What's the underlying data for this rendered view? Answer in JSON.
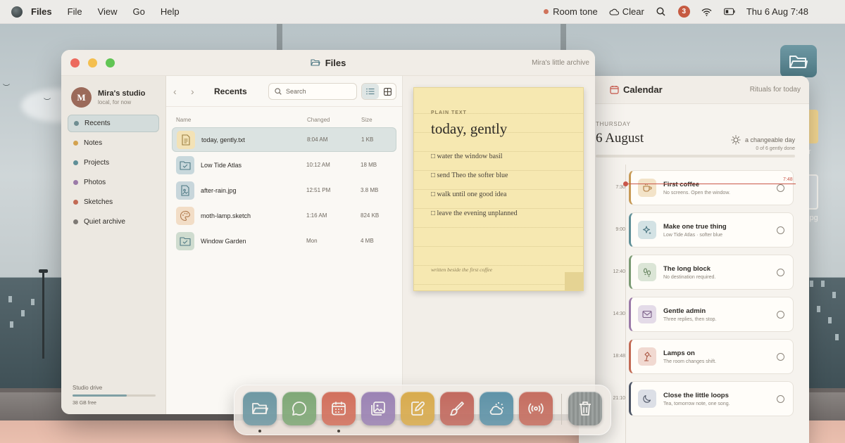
{
  "menubar": {
    "app": "Files",
    "menus": [
      "File",
      "View",
      "Go",
      "Help"
    ],
    "status": {
      "sound": "Room tone",
      "weather": "Clear",
      "notifications": "3",
      "datetime": "Thu 6 Aug  7:48"
    }
  },
  "files_window": {
    "title": "Files",
    "subtitle": "Mira's little archive",
    "profile": {
      "initial": "M",
      "name": "Mira's studio",
      "sub": "local, for now"
    },
    "sidebar": [
      {
        "label": "Recents",
        "color": "#6f8e92",
        "active": true
      },
      {
        "label": "Notes",
        "color": "#d3a24f"
      },
      {
        "label": "Projects",
        "color": "#5f8f97"
      },
      {
        "label": "Photos",
        "color": "#9b7aa8"
      },
      {
        "label": "Sketches",
        "color": "#c26a54"
      },
      {
        "label": "Quiet archive",
        "color": "#7e7a75"
      }
    ],
    "drive": {
      "label": "Studio drive",
      "used": 0.65,
      "free": "38 GB free"
    },
    "toolbar": {
      "title": "Recents",
      "search_placeholder": "Search"
    },
    "columns": {
      "name": "Name",
      "changed": "Changed",
      "size": "Size"
    },
    "files": [
      {
        "name": "today, gently.txt",
        "changed": "8:04 AM",
        "size": "1 KB",
        "icon": "text-file-icon",
        "bg": "#f3e2b6",
        "active": true
      },
      {
        "name": "Low Tide Atlas",
        "changed": "10:12 AM",
        "size": "18 MB",
        "icon": "folder-icon",
        "bg": "#c8d8dc"
      },
      {
        "name": "after-rain.jpg",
        "changed": "12:51 PM",
        "size": "3.8 MB",
        "icon": "image-file-icon",
        "bg": "#c8d6db"
      },
      {
        "name": "moth-lamp.sketch",
        "changed": "1:16 AM",
        "size": "824 KB",
        "icon": "palette-icon",
        "bg": "#f2ddc6"
      },
      {
        "name": "Window Garden",
        "changed": "Mon",
        "size": "4 MB",
        "icon": "folder-icon",
        "bg": "#cfdccf"
      }
    ],
    "preview": {
      "kind": "PLAIN TEXT",
      "title": "today, gently",
      "lines": [
        "□ water the window basil",
        "□ send Theo the softer blue",
        "□ walk until one good idea",
        "□ leave the evening unplanned"
      ],
      "footer": "written beside the first coffee"
    }
  },
  "calendar_window": {
    "title": "Calendar",
    "subtitle": "Rituals for today",
    "day": "THURSDAY",
    "date": "6 August",
    "weather": "a changeable day",
    "progress_text": "0 of 6 gently done",
    "progress": 0,
    "now_label": "7:48",
    "events": [
      {
        "time": "7:30",
        "title": "First coffee",
        "note": "No screens. Open the window.",
        "color": "#c79a55",
        "bg": "#f3e3c8",
        "icon": "coffee-icon"
      },
      {
        "time": "9:00",
        "title": "Make one true thing",
        "note": "Low Tide Atlas · softer blue",
        "color": "#5f8f97",
        "bg": "#d3e2e4",
        "icon": "sparkle-icon"
      },
      {
        "time": "12:40",
        "title": "The long block",
        "note": "No destination required.",
        "color": "#7a9a73",
        "bg": "#dbe5d6",
        "icon": "footprints-icon"
      },
      {
        "time": "14:30",
        "title": "Gentle admin",
        "note": "Three replies, then stop.",
        "color": "#9b7aa8",
        "bg": "#e4dbe8",
        "icon": "mail-icon"
      },
      {
        "time": "18:48",
        "title": "Lamps on",
        "note": "The room changes shift.",
        "color": "#c26a54",
        "bg": "#f1d9d1",
        "icon": "lamp-icon"
      },
      {
        "time": "21:10",
        "title": "Close the little loops",
        "note": "Tea, tomorrow note, one song.",
        "color": "#4d5566",
        "bg": "#dcdfe6",
        "icon": "moon-icon"
      }
    ]
  },
  "desktop": {
    "labels": [
      "s",
      "r",
      ".jpg"
    ]
  },
  "dock": [
    {
      "name": "files-app",
      "color": "#6e98a3",
      "running": true
    },
    {
      "name": "messages-app",
      "color": "#7fa877"
    },
    {
      "name": "calendar-app",
      "color": "#d2705d",
      "running": true
    },
    {
      "name": "photos-app",
      "color": "#9b83b4"
    },
    {
      "name": "notes-app",
      "color": "#d8ab4e"
    },
    {
      "name": "sketch-app",
      "color": "#c26a5f"
    },
    {
      "name": "weather-app",
      "color": "#5f93a8"
    },
    {
      "name": "radio-app",
      "color": "#c56e60"
    }
  ]
}
